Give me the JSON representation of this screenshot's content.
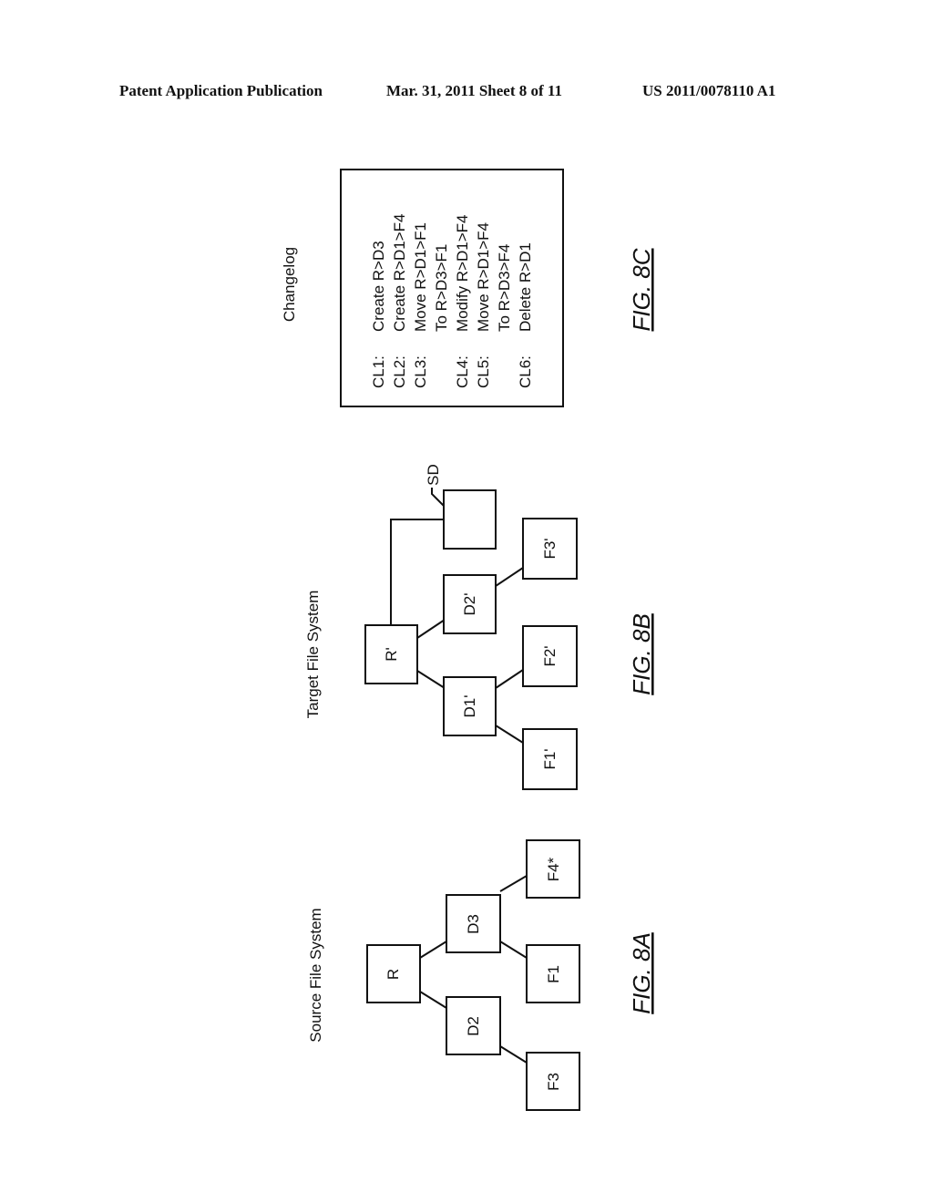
{
  "header": {
    "left": "Patent Application Publication",
    "middle": "Mar. 31, 2011  Sheet 8 of 11",
    "right": "US 2011/0078110 A1"
  },
  "fig_8a": {
    "title": "Source File System",
    "caption": "FIG. 8A",
    "nodes": {
      "r": "R",
      "d2": "D2",
      "d3": "D3",
      "f3": "F3",
      "f1": "F1",
      "f4": "F4*"
    },
    "edges": [
      [
        "R",
        "D2"
      ],
      [
        "R",
        "D3"
      ],
      [
        "D2",
        "F3"
      ],
      [
        "D3",
        "F1"
      ],
      [
        "D3",
        "F4*"
      ]
    ]
  },
  "fig_8b": {
    "title": "Target File System",
    "caption": "FIG. 8B",
    "nodes": {
      "r": "R'",
      "d1": "D1'",
      "d2": "D2'",
      "f1": "F1'",
      "f2": "F2'",
      "f3": "F3'",
      "sd": ""
    },
    "sd_label": "SD",
    "edges": [
      [
        "R'",
        "D1'"
      ],
      [
        "R'",
        "D2'"
      ],
      [
        "D1'",
        "F1'"
      ],
      [
        "D1'",
        "F2'"
      ],
      [
        "D2'",
        "F3'"
      ],
      [
        "R'",
        "SD"
      ]
    ]
  },
  "fig_8c": {
    "title": "Changelog",
    "caption": "FIG. 8C",
    "entries": [
      {
        "id": "CL1:",
        "lines": [
          "Create R>D3"
        ]
      },
      {
        "id": "CL2:",
        "lines": [
          "Create R>D1>F4"
        ]
      },
      {
        "id": "CL3:",
        "lines": [
          "Move R>D1>F1",
          "To R>D3>F1"
        ]
      },
      {
        "id": "CL4:",
        "lines": [
          "Modify R>D1>F4"
        ]
      },
      {
        "id": "CL5:",
        "lines": [
          "Move R>D1>F4",
          "To R>D3>F4"
        ]
      },
      {
        "id": "CL6:",
        "lines": [
          "Delete R>D1"
        ]
      }
    ]
  }
}
